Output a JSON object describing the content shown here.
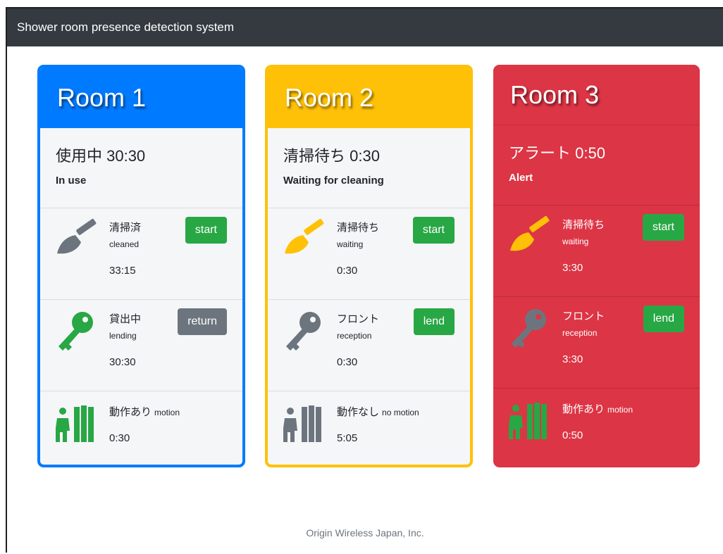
{
  "app": {
    "title": "Shower room presence detection system",
    "footer": "Origin Wireless Japan, Inc."
  },
  "colors": {
    "blue": "#007bff",
    "yellow": "#ffc107",
    "red": "#dc3545",
    "green": "#28a745",
    "gray": "#6c757d"
  },
  "rooms": [
    {
      "name": "Room 1",
      "status_jp": "使用中 30:30",
      "status_en": "In use",
      "cleaning": {
        "jp": "清掃済",
        "en": "cleaned",
        "time": "33:15",
        "button": "start",
        "icon": "broom-icon"
      },
      "key": {
        "jp": "貸出中",
        "en": "lending",
        "time": "30:30",
        "button": "return",
        "icon": "key-icon"
      },
      "motion": {
        "jp": "動作あり",
        "en": "motion",
        "time": "0:30",
        "icon": "shower-person-icon"
      }
    },
    {
      "name": "Room 2",
      "status_jp": "清掃待ち 0:30",
      "status_en": "Waiting for cleaning",
      "cleaning": {
        "jp": "清掃待ち",
        "en": "waiting",
        "time": "0:30",
        "button": "start",
        "icon": "broom-icon"
      },
      "key": {
        "jp": "フロント",
        "en": "reception",
        "time": "0:30",
        "button": "lend",
        "icon": "key-icon"
      },
      "motion": {
        "jp": "動作なし",
        "en": "no motion",
        "time": "5:05",
        "icon": "shower-person-icon"
      }
    },
    {
      "name": "Room 3",
      "status_jp": "アラート 0:50",
      "status_en": "Alert",
      "cleaning": {
        "jp": "清掃待ち",
        "en": "waiting",
        "time": "3:30",
        "button": "start",
        "icon": "broom-icon"
      },
      "key": {
        "jp": "フロント",
        "en": "reception",
        "time": "3:30",
        "button": "lend",
        "icon": "key-icon"
      },
      "motion": {
        "jp": "動作あり",
        "en": "motion",
        "time": "0:50",
        "icon": "shower-person-icon"
      }
    }
  ]
}
